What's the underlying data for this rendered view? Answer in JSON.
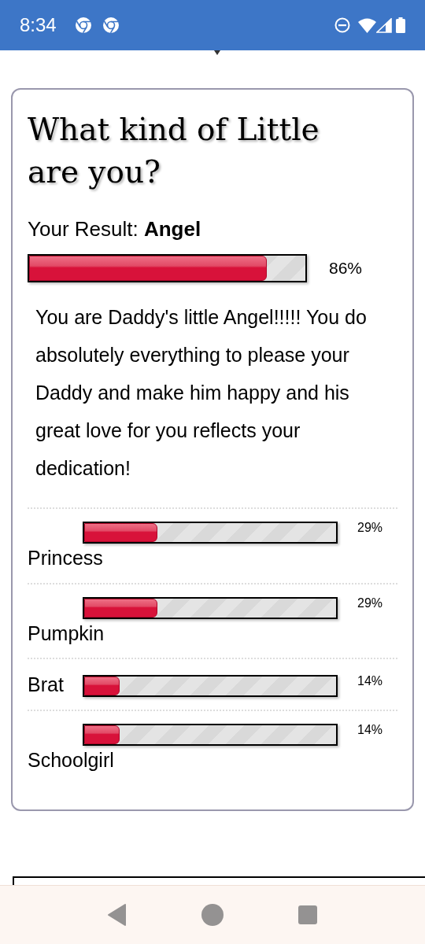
{
  "status_bar": {
    "time": "8:34"
  },
  "quiz": {
    "title": "What kind of Little are you?",
    "result_label": "Your Result:",
    "result_value": "Angel",
    "level": 0.86,
    "percent": "86%",
    "description": "You are Daddy's little Angel!!!!! You do absolutely everything to please your Daddy and make him happy and his great love for you reflects your dedication!",
    "others": [
      {
        "name": "Princess",
        "level": 0.29,
        "percent": "29%"
      },
      {
        "name": "Pumpkin",
        "level": 0.29,
        "percent": "29%"
      },
      {
        "name": "Brat",
        "level": 0.14,
        "percent": "14%"
      },
      {
        "name": "Schoolgirl",
        "level": 0.14,
        "percent": "14%"
      }
    ]
  }
}
